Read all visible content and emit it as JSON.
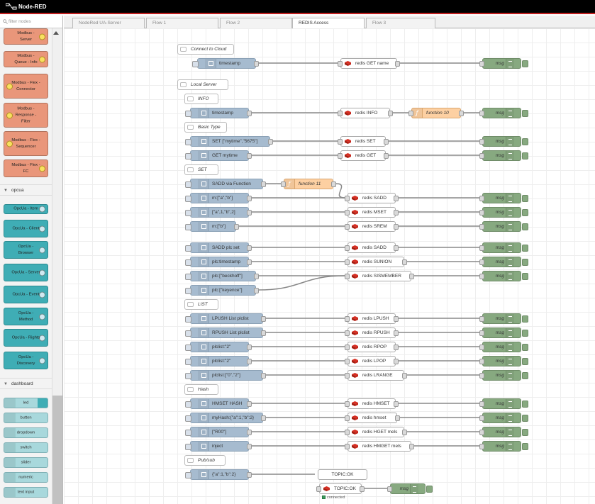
{
  "app": {
    "title": "Node-RED"
  },
  "palette": {
    "filter_placeholder": "filter nodes",
    "modbus_nodes": [
      "Modbus - Server",
      "Modbus - Queue - Info",
      "Modbus - Flex - Connector",
      "Modbus - Response - Filter",
      "Modbus - Flex - Sequencer",
      "Modbus - Flex - FC"
    ],
    "category_opcua": "opcua",
    "opcua_nodes": [
      "OpcUa - Item",
      "OpcUa - Client",
      "OpcUa - Browser",
      "OpcUa - Server",
      "OpcUa - Event",
      "OpcUa - Method",
      "OpcUa - Rights",
      "OpcUa - Discovery"
    ],
    "category_dashboard": "dashboard",
    "dashboard_nodes": [
      "led",
      "button",
      "dropdown",
      "switch",
      "slider",
      "numeric",
      "text input"
    ]
  },
  "tabs": [
    "NodeRed UA-Server",
    "Flow 1",
    "Flow 2",
    "REDIS Access",
    "Flow 3"
  ],
  "active_tab": "REDIS Access",
  "flow": {
    "comments": [
      "Connect to Cloud",
      "Local Server",
      "INFO",
      "Basic Type",
      "SET",
      "LIST",
      "Hash",
      "Pub/sub"
    ],
    "injects": [
      "timestamp",
      "timestamp",
      "SET [\"mytime\",\"5675\"]",
      "GET mytime",
      "SADD via Function",
      "m:[\"a\",\"b\"]",
      "[\"a\",1,\"b\",2]",
      "m:[\"b\"]",
      "SADD plc set",
      "plc:timestamp",
      "plc:[\"beckhoff\"]",
      "plc:[\"keyence\"]",
      "LPUSH List plclist",
      "RPUSH List plclist",
      "plclist:\"2\"",
      "plclist:\"2\"",
      "plclist:[\"0\",\"2\"]",
      "HMSET HASH",
      "myHash:{\"a\":1,\"b\":2}",
      "[\"R00\"]",
      "inject",
      "{\"a\":1,\"b\":2}"
    ],
    "redis": [
      "redis GET name",
      "redis INFO",
      "redis SET",
      "redis GET",
      "redis SADD",
      "redis MSET",
      "redis SREM",
      "redis SADD",
      "redis SUNION",
      "redis SISMEMBER",
      "redis LPUSH",
      "redis RPUSH",
      "redis RPOP",
      "redis LPOP",
      "redis LRANGE",
      "redis HMSET",
      "redis hmset",
      "redis HGET mels",
      "redis HMGET mels"
    ],
    "functions": [
      "function 10",
      "function 11"
    ],
    "debug_label": "msg",
    "topic_out": "TOPIC:OK",
    "topic_in": "TOPIC:OK",
    "topic_status": "connected"
  },
  "colors": {
    "inject": "#a6bbcf",
    "function": "#fdd0a2",
    "debug": "#87a980",
    "modbus": "#e9967a",
    "opcua": "#3fadb5",
    "dashboard": "#a8d8dc",
    "header_accent": "#c02020"
  }
}
